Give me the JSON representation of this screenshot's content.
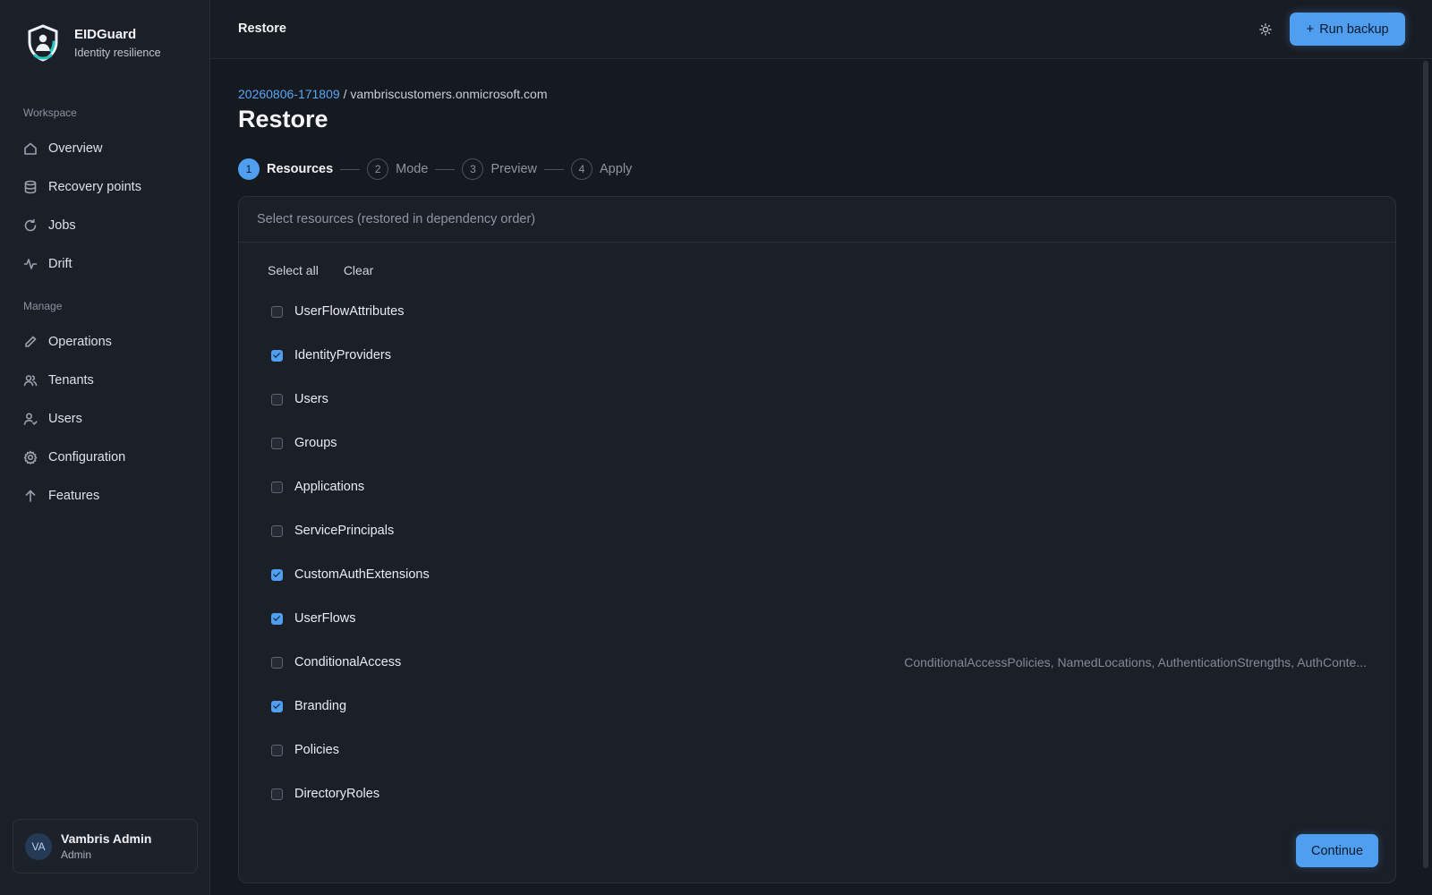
{
  "brand": {
    "name": "EIDGuard",
    "tagline": "Identity resilience",
    "logo_icon": "shield-user-icon"
  },
  "sidebar": {
    "sections": [
      {
        "label": "Workspace"
      },
      {
        "label": "Manage"
      }
    ],
    "items": [
      {
        "label": "Overview",
        "icon": "home-icon"
      },
      {
        "label": "Recovery points",
        "icon": "database-icon"
      },
      {
        "label": "Jobs",
        "icon": "refresh-icon"
      },
      {
        "label": "Drift",
        "icon": "activity-icon"
      },
      {
        "label": "Operations",
        "icon": "pencil-icon"
      },
      {
        "label": "Tenants",
        "icon": "users-icon"
      },
      {
        "label": "Users",
        "icon": "user-check-icon"
      },
      {
        "label": "Configuration",
        "icon": "gear-icon"
      },
      {
        "label": "Features",
        "icon": "arrow-up-icon"
      }
    ]
  },
  "user": {
    "initials": "VA",
    "name": "Vambris Admin",
    "role": "Admin"
  },
  "header": {
    "title": "Restore",
    "theme_icon": "sun-icon",
    "run_backup_label": "Run backup",
    "run_backup_icon": "+"
  },
  "breadcrumb": {
    "recovery_point": "20260806-171809",
    "separator": "/",
    "tenant": "vambriscustomers.onmicrosoft.com"
  },
  "page": {
    "title": "Restore"
  },
  "stepper": {
    "steps": [
      {
        "number": "1",
        "label": "Resources",
        "active": true
      },
      {
        "number": "2",
        "label": "Mode",
        "active": false
      },
      {
        "number": "3",
        "label": "Preview",
        "active": false
      },
      {
        "number": "4",
        "label": "Apply",
        "active": false
      }
    ]
  },
  "panel": {
    "heading": "Select resources (restored in dependency order)",
    "select_all_label": "Select all",
    "clear_label": "Clear",
    "continue_label": "Continue",
    "resources": [
      {
        "label": "UserFlowAttributes",
        "checked": false,
        "detail": ""
      },
      {
        "label": "IdentityProviders",
        "checked": true,
        "detail": ""
      },
      {
        "label": "Users",
        "checked": false,
        "detail": ""
      },
      {
        "label": "Groups",
        "checked": false,
        "detail": ""
      },
      {
        "label": "Applications",
        "checked": false,
        "detail": ""
      },
      {
        "label": "ServicePrincipals",
        "checked": false,
        "detail": ""
      },
      {
        "label": "CustomAuthExtensions",
        "checked": true,
        "detail": ""
      },
      {
        "label": "UserFlows",
        "checked": true,
        "detail": ""
      },
      {
        "label": "ConditionalAccess",
        "checked": false,
        "detail": "ConditionalAccessPolicies, NamedLocations, AuthenticationStrengths, AuthConte..."
      },
      {
        "label": "Branding",
        "checked": true,
        "detail": ""
      },
      {
        "label": "Policies",
        "checked": false,
        "detail": ""
      },
      {
        "label": "DirectoryRoles",
        "checked": false,
        "detail": ""
      }
    ]
  },
  "colors": {
    "accent": "#4f9ef0",
    "background": "#151920",
    "sidebar": "#1b1f27",
    "panel": "#1b1f27"
  }
}
